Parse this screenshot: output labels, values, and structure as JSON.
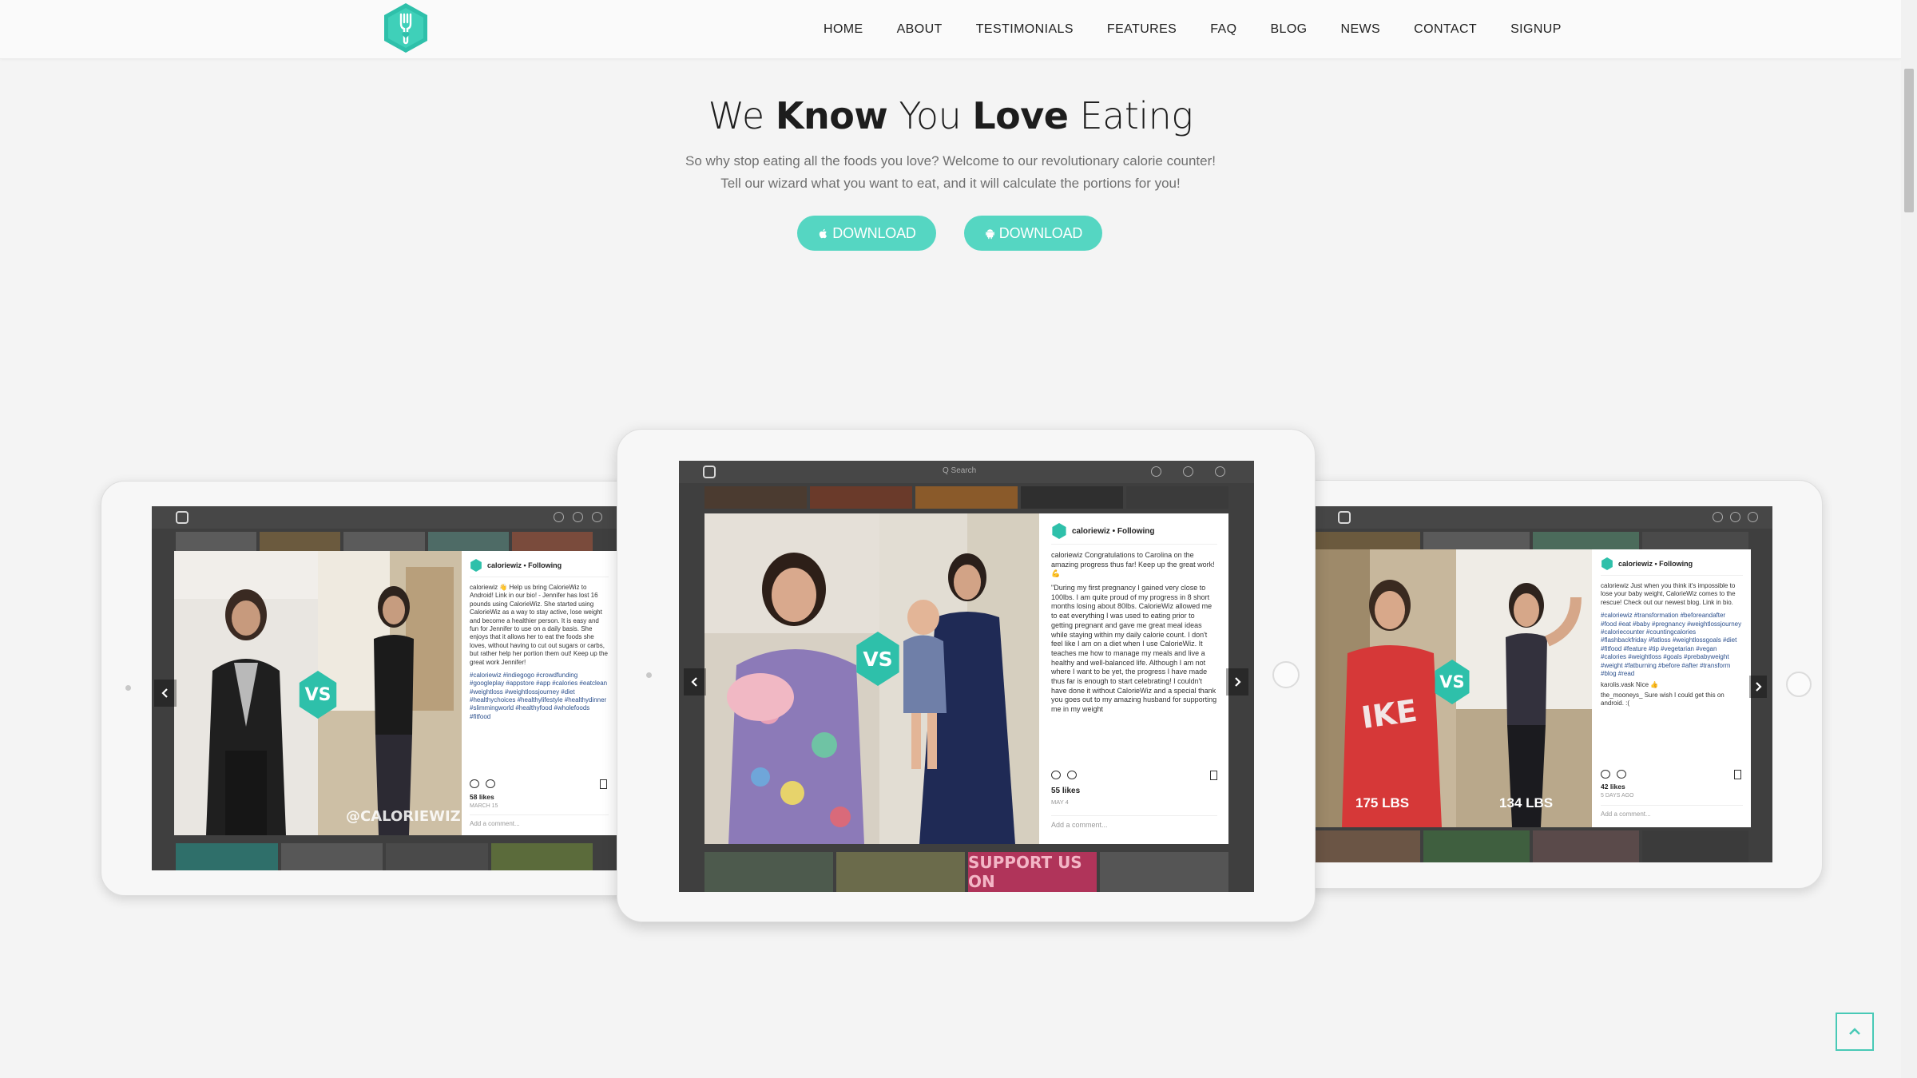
{
  "nav": {
    "logo_icon": "fork-heart-hexagon-logo",
    "items": [
      "HOME",
      "ABOUT",
      "TESTIMONIALS",
      "FEATURES",
      "FAQ",
      "BLOG",
      "NEWS",
      "CONTACT",
      "SIGNUP"
    ]
  },
  "hero": {
    "title_parts": [
      "We ",
      "Know",
      " You ",
      "Love",
      " Eating"
    ],
    "subtitle_line1": "So why stop eating all the foods you love? Welcome to our revolutionary calorie counter!",
    "subtitle_line2": "Tell our wizard what you want to eat, and it will calculate the portions for you!",
    "download_ios": "DOWNLOAD",
    "download_android": "DOWNLOAD"
  },
  "slides": {
    "left": {
      "username": "caloriewiz • Following",
      "caption": "caloriewiz 👋 Help us bring CalorieWiz to Android! Link in our bio! - Jennifer has lost 16 pounds using CalorieWiz. She started using CalorieWiz as a way to stay active, lose weight and become a healthier person. It is easy and fun for Jennifer to use on a daily basis. She enjoys that it allows her to eat the foods she loves, without having to cut out sugars or carbs, but rather help her portion them out! Keep up the great work Jennifer!",
      "tags": "#caloriewiz #indiegogo #crowdfunding #googleplay #appstore #app #calories #eatclean #weightloss #weightlossjourney #diet #healthychoices #healthylifestyle #healthydinner #slimmingworld #healthyfood #wholefoods #fitfood",
      "likes": "58 likes",
      "date": "MARCH 15",
      "comment_placeholder": "Add a comment...",
      "watermark": "@CALORIEWIZ",
      "vs": "VS"
    },
    "center": {
      "username": "caloriewiz • Following",
      "caption": "caloriewiz Congratulations to Carolina on the amazing progress thus far! Keep up the great work! 💪",
      "caption2": "\"During my first pregnancy I gained very close to 100lbs. I am quite proud of my progress in 8 short months losing about 80lbs. CalorieWiz allowed me to eat everything I was used to eating prior to getting pregnant and gave me great meal ideas while staying within my daily calorie count. I don't feel like I am on a diet when I use CalorieWiz. It teaches me how to manage my meals and live a healthy and well-balanced life. Although I am not where I want to be yet, the progress I have made thus far is enough to start celebrating! I couldn't have done it without CalorieWiz and a special thank you goes out to my amazing husband for supporting me in my weight",
      "likes": "55 likes",
      "date": "MAY 4",
      "comment_placeholder": "Add a comment...",
      "search": "Q Search",
      "vs": "VS",
      "bottom_banner": "SUPPORT US ON"
    },
    "right": {
      "username": "caloriewiz • Following",
      "caption": "caloriewiz Just when you think it's impossible to lose your baby weight, CalorieWiz comes to the rescue! Check out our newest blog. Link in bio.",
      "tags": "#caloriewiz #transformation #beforeandafter #food #eat #baby #pregnancy #weightlossjourney #caloriecounter #countingcalories #flashbackfriday #fatloss #weightlossgoals #diet #fitfood #feature #tip #vegetarian #vegan #calories #weightloss #goals #prebabyweight #weight #fatburning #before #after #transform #blog #read",
      "likes": "42 likes",
      "commenter": "karolis.vask Nice 👍",
      "commenter2": "the_mooneys_ Sure wish I could get this on android. :(",
      "date": "5 DAYS AGO",
      "comment_placeholder": "Add a comment...",
      "before_label": "175 LBS",
      "after_label": "134 LBS",
      "vs": "VS"
    }
  },
  "colors": {
    "accent": "#55d6c2",
    "teal_dark": "#2ec0aa",
    "background": "#f4f4f4"
  }
}
